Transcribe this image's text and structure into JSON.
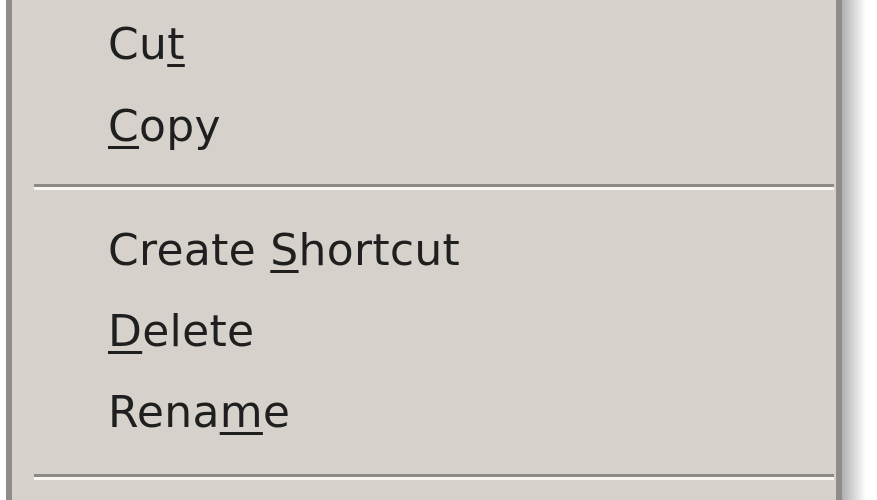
{
  "context_menu": {
    "items": [
      {
        "pre": "Cu",
        "key": "t",
        "post": ""
      },
      {
        "pre": "",
        "key": "C",
        "post": "opy"
      },
      {
        "pre": "Create ",
        "key": "S",
        "post": "hortcut"
      },
      {
        "pre": "",
        "key": "D",
        "post": "elete"
      },
      {
        "pre": "Rena",
        "key": "m",
        "post": "e"
      }
    ]
  },
  "colors": {
    "menu_background": "#d6d2cb",
    "text": "#1f1f1f",
    "separator_dark": "#8c8a86",
    "separator_light": "#f7f6f3"
  }
}
